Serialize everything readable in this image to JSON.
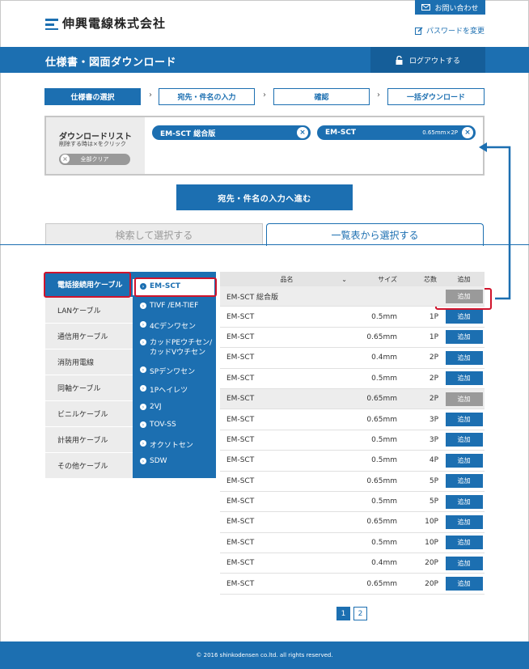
{
  "header": {
    "logo_text": "伸興電線株式会社",
    "contact_label": "お問い合わせ",
    "password_label": "パスワードを変更"
  },
  "titlebar": {
    "title": "仕様書・図面ダウンロード",
    "logout_label": "ログアウトする"
  },
  "steps": [
    {
      "label": "仕様書の選択",
      "active": true
    },
    {
      "label": "宛先・件名の入力",
      "active": false
    },
    {
      "label": "確認",
      "active": false
    },
    {
      "label": "一括ダウンロード",
      "active": false
    }
  ],
  "download_list": {
    "title": "ダウンロードリスト",
    "hint": "削除する時は×をクリック",
    "clear_label": "全部クリア",
    "items": [
      {
        "name": "EM-SCT 総合版",
        "size": ""
      },
      {
        "name": "EM-SCT",
        "size": "0.65mm×2P"
      }
    ]
  },
  "proceed_label": "宛先・件名の入力へ進む",
  "tabs": {
    "search": "検索して選択する",
    "list": "一覧表から選択する"
  },
  "categories": [
    {
      "label": "電話接続用ケーブル",
      "active": true
    },
    {
      "label": "LANケーブル",
      "active": false
    },
    {
      "label": "通信用ケーブル",
      "active": false
    },
    {
      "label": "消防用電線",
      "active": false
    },
    {
      "label": "同軸ケーブル",
      "active": false
    },
    {
      "label": "ビニルケーブル",
      "active": false
    },
    {
      "label": "計装用ケーブル",
      "active": false
    },
    {
      "label": "その他ケーブル",
      "active": false
    }
  ],
  "subcategories": [
    {
      "label": "EM-SCT",
      "active": true
    },
    {
      "label": "TIVF /EM-TIEF",
      "active": false
    },
    {
      "label": "4Cデンワセン",
      "active": false
    },
    {
      "label": "カッドPEウチセン/カッドVウチセン",
      "active": false
    },
    {
      "label": "SPデンワセン",
      "active": false
    },
    {
      "label": "1Pヘイレツ",
      "active": false
    },
    {
      "label": "2VJ",
      "active": false
    },
    {
      "label": "TOV-SS",
      "active": false
    },
    {
      "label": "オクソトセン",
      "active": false
    },
    {
      "label": "SDW",
      "active": false
    }
  ],
  "table": {
    "headers": {
      "name": "品名",
      "size": "サイズ",
      "cores": "芯数",
      "add": "追加"
    },
    "rows": [
      {
        "name": "EM-SCT 総合版",
        "size": "",
        "cores": "",
        "add": "追加",
        "added": true
      },
      {
        "name": "EM-SCT",
        "size": "0.5mm",
        "cores": "1P",
        "add": "追加",
        "added": false
      },
      {
        "name": "EM-SCT",
        "size": "0.65mm",
        "cores": "1P",
        "add": "追加",
        "added": false
      },
      {
        "name": "EM-SCT",
        "size": "0.4mm",
        "cores": "2P",
        "add": "追加",
        "added": false
      },
      {
        "name": "EM-SCT",
        "size": "0.5mm",
        "cores": "2P",
        "add": "追加",
        "added": false
      },
      {
        "name": "EM-SCT",
        "size": "0.65mm",
        "cores": "2P",
        "add": "追加",
        "added": true
      },
      {
        "name": "EM-SCT",
        "size": "0.65mm",
        "cores": "3P",
        "add": "追加",
        "added": false
      },
      {
        "name": "EM-SCT",
        "size": "0.5mm",
        "cores": "3P",
        "add": "追加",
        "added": false
      },
      {
        "name": "EM-SCT",
        "size": "0.5mm",
        "cores": "4P",
        "add": "追加",
        "added": false
      },
      {
        "name": "EM-SCT",
        "size": "0.65mm",
        "cores": "5P",
        "add": "追加",
        "added": false
      },
      {
        "name": "EM-SCT",
        "size": "0.5mm",
        "cores": "5P",
        "add": "追加",
        "added": false
      },
      {
        "name": "EM-SCT",
        "size": "0.65mm",
        "cores": "10P",
        "add": "追加",
        "added": false
      },
      {
        "name": "EM-SCT",
        "size": "0.5mm",
        "cores": "10P",
        "add": "追加",
        "added": false
      },
      {
        "name": "EM-SCT",
        "size": "0.4mm",
        "cores": "20P",
        "add": "追加",
        "added": false
      },
      {
        "name": "EM-SCT",
        "size": "0.65mm",
        "cores": "20P",
        "add": "追加",
        "added": false
      }
    ]
  },
  "pagination": {
    "current": "1",
    "next": "2"
  },
  "footer": {
    "copyright": "© 2016 shinkodensen co.ltd. all rights reserved."
  },
  "colors": {
    "primary": "#1c6fb1",
    "highlight": "#d0142c",
    "disabled": "#9a9a9a"
  },
  "icons": [
    "mail-icon",
    "pencil-icon",
    "lock-icon",
    "close-icon",
    "chevron-right-icon",
    "chevron-down-icon"
  ]
}
